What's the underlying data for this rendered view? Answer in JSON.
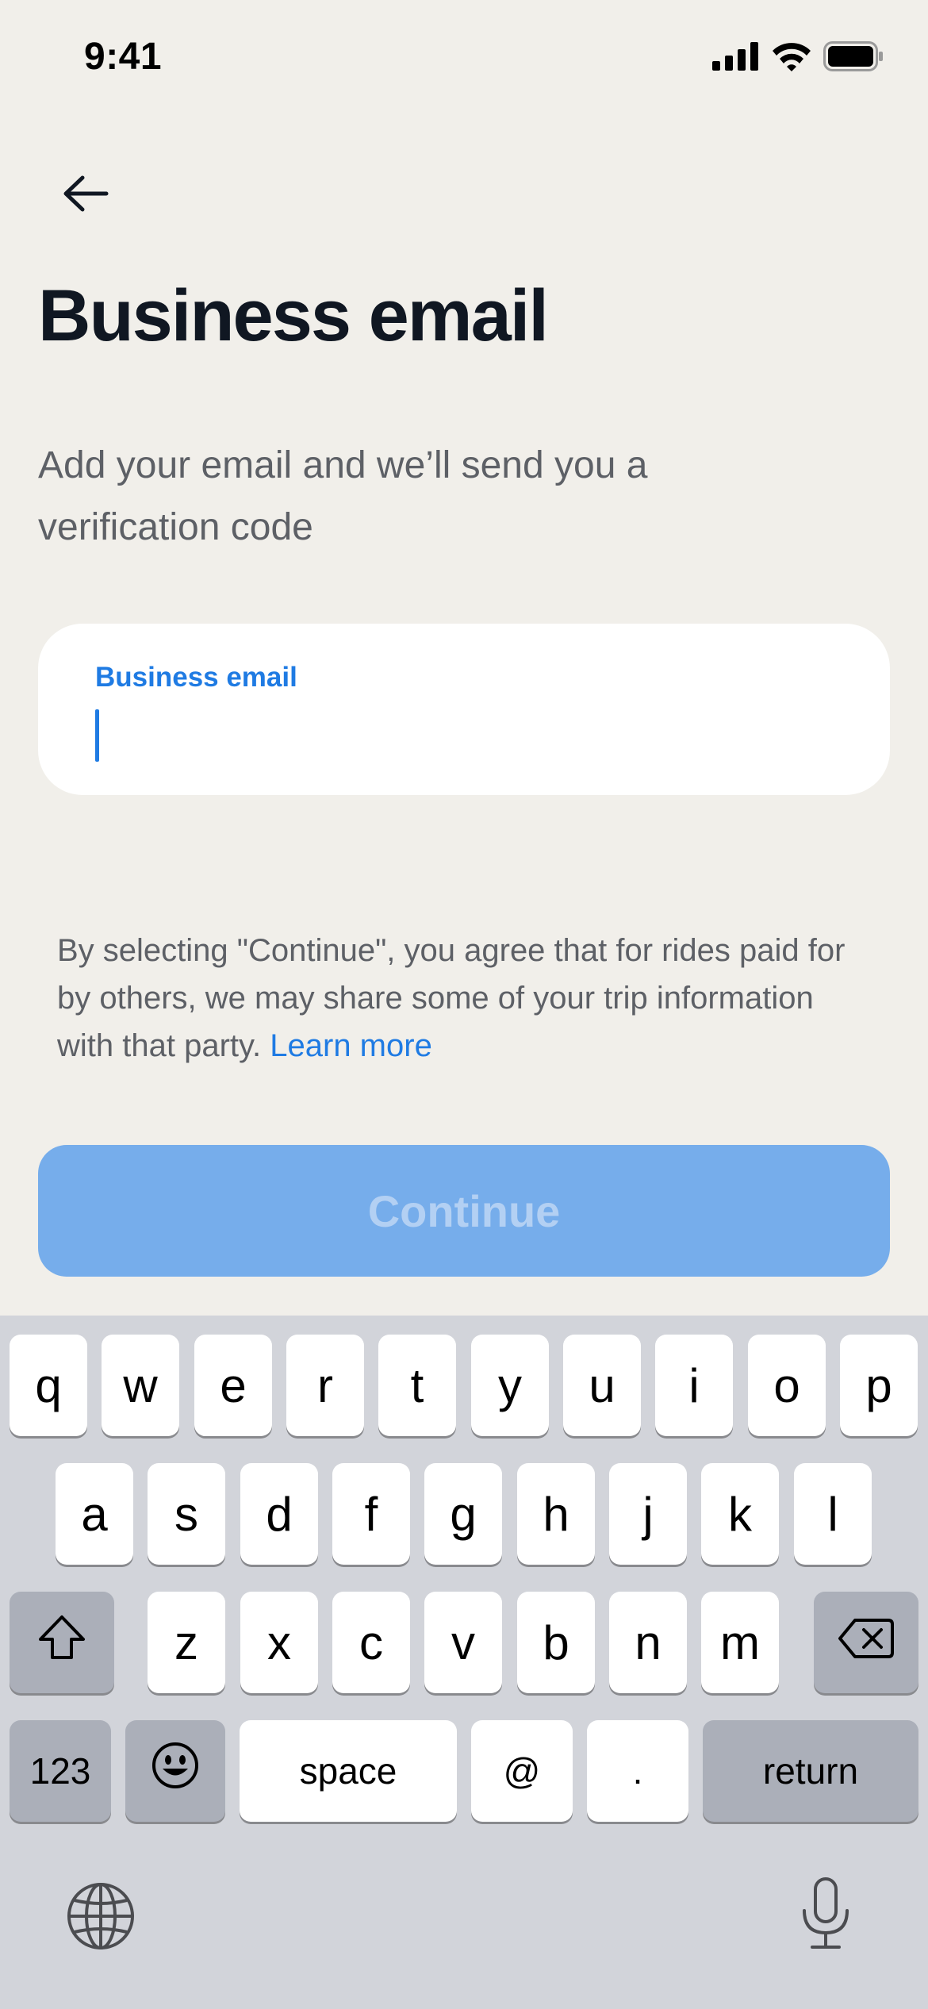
{
  "status_bar": {
    "time": "9:41",
    "icons": [
      "cellular-signal-icon",
      "wifi-icon",
      "battery-icon"
    ]
  },
  "navigation": {
    "back_icon": "arrow-left-icon"
  },
  "header": {
    "title": "Business email",
    "subtitle": "Add your email and we’ll send you a verification code"
  },
  "email_field": {
    "label": "Business email",
    "value": "",
    "placeholder": ""
  },
  "disclaimer": {
    "text": "By selecting \"Continue\", you agree that for rides paid for by others, we may share some of your trip information with that party. ",
    "link_label": "Learn more"
  },
  "continue_button": {
    "label": "Continue",
    "enabled": false
  },
  "keyboard": {
    "row1": [
      "q",
      "w",
      "e",
      "r",
      "t",
      "y",
      "u",
      "i",
      "o",
      "p"
    ],
    "row2": [
      "a",
      "s",
      "d",
      "f",
      "g",
      "h",
      "j",
      "k",
      "l"
    ],
    "row3": [
      "z",
      "x",
      "c",
      "v",
      "b",
      "n",
      "m"
    ],
    "numbers_label": "123",
    "space_label": "space",
    "at_label": "@",
    "period_label": ".",
    "return_label": "return",
    "icons": [
      "shift-icon",
      "backspace-icon",
      "emoji-icon",
      "globe-icon",
      "microphone-icon"
    ]
  },
  "colors": {
    "background": "#F1EFEA",
    "accent": "#1F7BE3",
    "button_disabled": "#76ADEB",
    "keyboard_background": "#D2D4DA"
  }
}
